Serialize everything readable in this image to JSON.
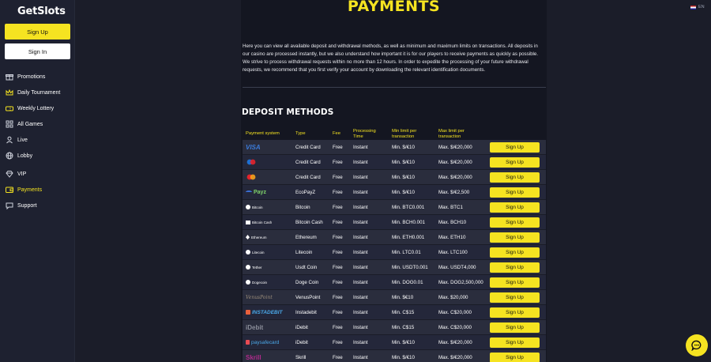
{
  "sidebar": {
    "logo": "GetSlots",
    "signup_label": "Sign Up",
    "signin_label": "Sign In",
    "items": [
      {
        "label": "Promotions",
        "icon": "gift-icon"
      },
      {
        "label": "Daily Tournament",
        "icon": "crown-icon"
      },
      {
        "label": "Weekly Lottery",
        "icon": "ticket-icon"
      },
      {
        "label": "All Games",
        "icon": "grid-icon"
      },
      {
        "label": "Live",
        "icon": "person-icon"
      },
      {
        "label": "Lobby",
        "icon": "globe-icon"
      },
      {
        "label": "VIP",
        "icon": "diamond-icon"
      },
      {
        "label": "Payments",
        "icon": "wallet-icon",
        "active": true
      },
      {
        "label": "Support",
        "icon": "chat-icon"
      }
    ]
  },
  "header": {
    "language": "EN"
  },
  "main": {
    "title": "PAYMENTS",
    "intro": "Here you can view all available deposit and withdrawal methods, as well as minimum and maximum limits on transactions. All deposits in our casino are processed instantly, but we also understand how important it is for our players to receive payments as quickly as possible. We strive to process withdrawal requests within no more than 12 hours. In order to expedite the processing of your future withdrawal requests, we recommend that you first verify your account by downloading the relevant identification documents.",
    "deposit_title": "DEPOSIT METHODS",
    "columns": [
      "Payment system",
      "Type",
      "Fee",
      "Processing Time",
      "Min limit per transaction",
      "Max limit per transaction"
    ],
    "signup_label": "Sign Up",
    "rows": [
      {
        "logo": "VISA",
        "type": "Credit Card",
        "fee": "Free",
        "time": "Instant",
        "min": "Min. $/€10",
        "max": "Max. $/€20,000"
      },
      {
        "logo": "Maestro",
        "type": "Credit Card",
        "fee": "Free",
        "time": "Instant",
        "min": "Min. $/€10",
        "max": "Max. $/€20,000"
      },
      {
        "logo": "Mastercard",
        "type": "Credit Card",
        "fee": "Free",
        "time": "Instant",
        "min": "Min. $/€10",
        "max": "Max. $/€20,000"
      },
      {
        "logo": "Payz",
        "type": "EcoPayZ",
        "fee": "Free",
        "time": "Instant",
        "min": "Min. $/€10",
        "max": "Max. $/€2,500"
      },
      {
        "logo": "Bitcoin",
        "type": "Bitcoin",
        "fee": "Free",
        "time": "Instant",
        "min": "Min. BTC0.001",
        "max": "Max. BTC1"
      },
      {
        "logo": "Bitcoin Cash",
        "type": "Bitcoin Cash",
        "fee": "Free",
        "time": "Instant",
        "min": "Min. BCH0.001",
        "max": "Max. BCH10"
      },
      {
        "logo": "Ethereum",
        "type": "Ethereum",
        "fee": "Free",
        "time": "Instant",
        "min": "Min. ETH0.001",
        "max": "Max. ETH10"
      },
      {
        "logo": "Litecoin",
        "type": "Litecoin",
        "fee": "Free",
        "time": "Instant",
        "min": "Min. LTC0.01",
        "max": "Max. LTC100"
      },
      {
        "logo": "Tether",
        "type": "Usdt Coin",
        "fee": "Free",
        "time": "Instant",
        "min": "Min. USDT0.001",
        "max": "Max. USDT4,000"
      },
      {
        "logo": "Dogecoin",
        "type": "Doge Coin",
        "fee": "Free",
        "time": "Instant",
        "min": "Min. DOG0.01",
        "max": "Max. DOG2,500,000"
      },
      {
        "logo": "VenusPoint",
        "type": "VenusPoint",
        "fee": "Free",
        "time": "Instant",
        "min": "Min. $€10",
        "max": "Max. $20,000"
      },
      {
        "logo": "INSTADEBIT",
        "type": "Instadebit",
        "fee": "Free",
        "time": "Instant",
        "min": "Min. C$15",
        "max": "Max. C$20,000"
      },
      {
        "logo": "iDebit",
        "type": "iDebit",
        "fee": "Free",
        "time": "Instant",
        "min": "Min. C$15",
        "max": "Max. C$20,000"
      },
      {
        "logo": "paysafecard",
        "type": "iDebit",
        "fee": "Free",
        "time": "Instant",
        "min": "Min. $/€10",
        "max": "Max. $/€20,000"
      },
      {
        "logo": "Skrill",
        "type": "Skrill",
        "fee": "Free",
        "time": "Instant",
        "min": "Min. $/€10",
        "max": "Max. $/€20,000"
      }
    ]
  },
  "colors": {
    "accent": "#f5e321",
    "background": "#1b1d29",
    "panel": "#141621"
  }
}
